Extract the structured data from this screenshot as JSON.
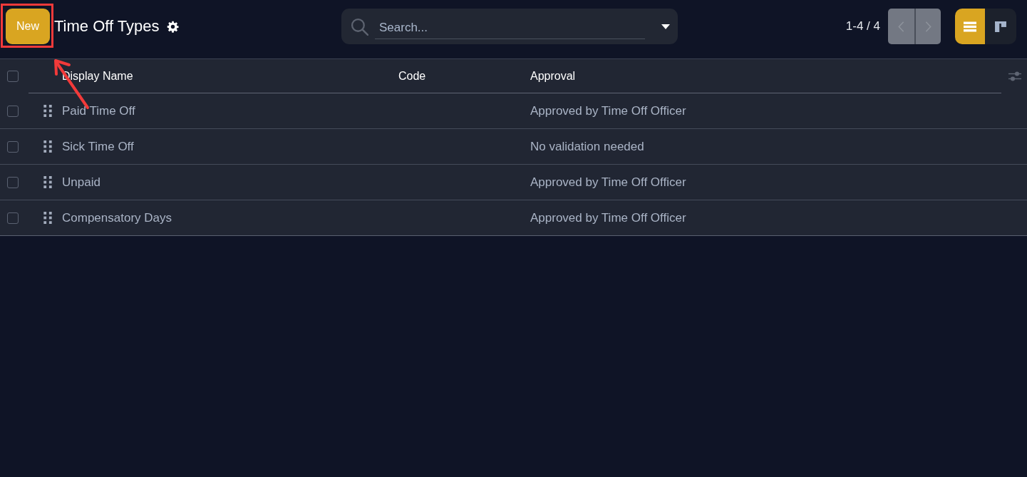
{
  "toolbar": {
    "new_button": "New",
    "title": "Time Off Types",
    "search": {
      "placeholder": "Search..."
    },
    "pager": {
      "value": "1-4 / 4",
      "previous_disabled": true,
      "next_disabled": true
    },
    "views": [
      {
        "kind": "list",
        "selected": true
      },
      {
        "kind": "kanban",
        "selected": false
      }
    ]
  },
  "table": {
    "select_all_checked": false,
    "columns": [
      "Display Name",
      "Code",
      "Approval"
    ],
    "rows": [
      {
        "name": "Paid Time Off",
        "approval": "Approved by Time Off Officer",
        "checked": false
      },
      {
        "name": "Sick Time Off",
        "approval": "No validation needed",
        "checked": false
      },
      {
        "name": "Unpaid",
        "approval": "Approved by Time Off Officer",
        "checked": false
      },
      {
        "name": "Compensatory Days",
        "approval": "Approved by Time Off Officer",
        "checked": false
      }
    ]
  },
  "callouts": {
    "highlight_box": true,
    "arrow": true
  }
}
